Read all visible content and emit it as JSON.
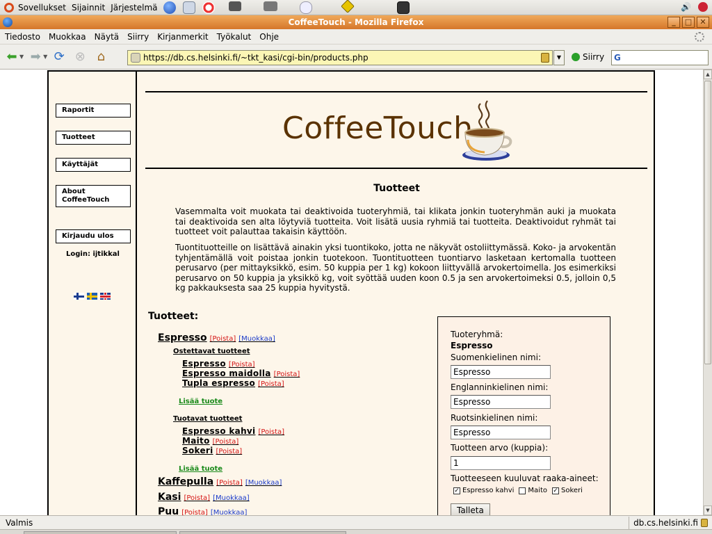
{
  "gnome_panel": {
    "menus": [
      "Sovellukset",
      "Sijainnit",
      "Järjestelmä"
    ]
  },
  "window": {
    "title": "CoffeeTouch - Mozilla Firefox",
    "buttons": [
      "_",
      "□",
      "✕"
    ]
  },
  "menubar": {
    "items": [
      "Tiedosto",
      "Muokkaa",
      "Näytä",
      "Siirry",
      "Kirjanmerkit",
      "Työkalut",
      "Ohje"
    ]
  },
  "navbar": {
    "url": "https://db.cs.helsinki.fi/~tkt_kasi/cgi-bin/products.php",
    "go_label": "Siirry",
    "search_placeholder": ""
  },
  "sidebar": {
    "buttons": [
      {
        "label": "Raportit"
      },
      {
        "label": "Tuotteet"
      },
      {
        "label": "Käyttäjät"
      },
      {
        "label": "About\nCoffeeTouch"
      },
      {
        "label": "Kirjaudu ulos"
      }
    ],
    "login": "Login: ijtikkal"
  },
  "header": {
    "logo_text": "CoffeeTouch",
    "page_title": "Tuotteet"
  },
  "intro": {
    "p1": "Vasemmalta voit muokata tai deaktivoida tuoteryhmiä, tai klikata jonkin tuoteryhmän auki ja muokata tai deaktivoida sen alta löytyviä tuotteita. Voit lisätä uusia ryhmiä tai tuotteita. Deaktivoidut ryhmät tai tuotteet voit palauttaa takaisin käyttöön.",
    "p2": "Tuontituotteille on lisättävä ainakin yksi tuontikoko, jotta ne näkyvät ostoliittymässä. Koko- ja arvokentän tyhjentämällä voit poistaa jonkin tuotekoon. Tuontituotteen tuontiarvo lasketaan kertomalla tuotteen perusarvo (per mittayksikkö, esim. 50 kuppia per 1 kg) kokoon liittyvällä arvokertoimella. Jos esimerkiksi perusarvo on 50 kuppia ja yksikkö kg, voit syöttää uuden koon 0.5 ja sen arvokertoimeksi 0.5, jolloin 0,5 kg pakkauksesta saa 25 kuppia hyvitystä."
  },
  "products": {
    "title": "Tuotteet:",
    "delete_label": "[Poista]",
    "edit_label": "[Muokkaa]",
    "add_label": "Lisää tuote",
    "groups": [
      {
        "name": "Espresso"
      },
      {
        "name": "Kaffepulla"
      },
      {
        "name": "Kasi"
      },
      {
        "name": "Puu"
      }
    ],
    "bought_heading": "Ostettavat tuotteet",
    "bought_items": [
      "Espresso",
      "Espresso maidolla",
      "Tupla espresso"
    ],
    "produced_heading": "Tuotavat tuotteet",
    "produced_items": [
      "Espresso kahvi",
      "Maito",
      "Sokeri"
    ]
  },
  "form": {
    "group_label": "Tuoteryhmä:",
    "group_value": "Espresso",
    "fi_label": "Suomenkielinen nimi:",
    "fi_value": "Espresso",
    "en_label": "Englanninkielinen nimi:",
    "en_value": "Espresso",
    "sv_label": "Ruotsinkielinen nimi:",
    "sv_value": "Espresso",
    "value_label": "Tuotteen arvo (kuppia):",
    "value_value": "1",
    "ingredients_label": "Tuotteeseen kuuluvat raaka-aineet:",
    "ingredients": [
      {
        "label": "Espresso kahvi",
        "checked": true
      },
      {
        "label": "Maito",
        "checked": false
      },
      {
        "label": "Sokeri",
        "checked": true
      }
    ],
    "save_label": "Talleta"
  },
  "statusbar": {
    "status": "Valmis",
    "host": "db.cs.helsinki.fi"
  },
  "colors": {
    "page_bg": "#fdf6ea",
    "logo_brown": "#5a3200",
    "delete_red": "#d41414",
    "edit_blue": "#1a3ac9",
    "add_green": "#1a8a1a",
    "title_orange": "#d5762a",
    "url_yellow": "#fbf6b5"
  }
}
